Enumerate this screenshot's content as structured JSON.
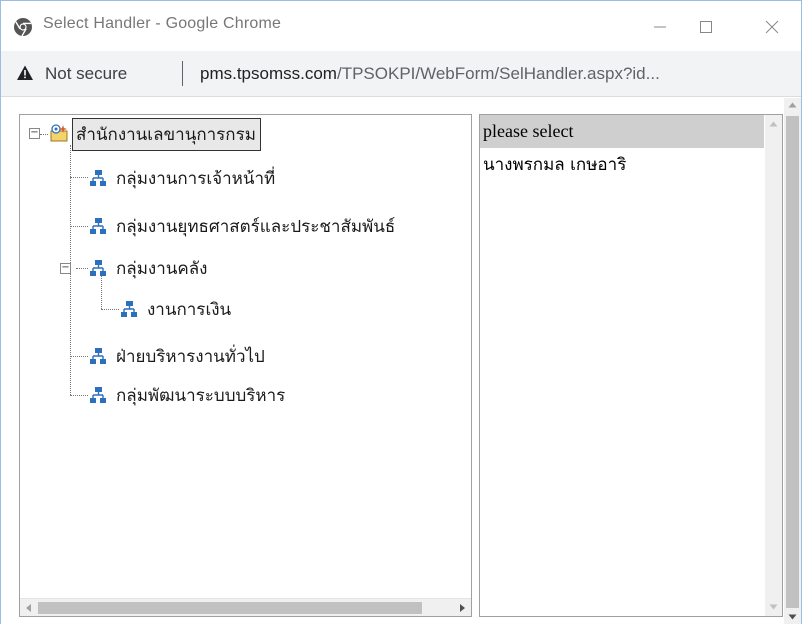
{
  "window": {
    "title": "Select Handler - Google Chrome",
    "controls": {
      "minimize": "minimize-icon",
      "maximize": "maximize-icon",
      "close": "close-icon"
    }
  },
  "addressbar": {
    "security_label": "Not secure",
    "url_host": "pms.tpsomss.com",
    "url_path": "/TPSOKPI/WebForm/SelHandler.aspx?id..."
  },
  "tree": {
    "root": {
      "label": "สำนักงานเลขานุการกรม",
      "icon": "folder-sparkle-icon",
      "expanded": true
    },
    "nodes": [
      {
        "label": "กลุ่มงานการเจ้าหน้าที่",
        "icon": "org-chart-icon"
      },
      {
        "label": "กลุ่มงานยุทธศาสตร์และประชาสัมพันธ์",
        "icon": "org-chart-icon"
      },
      {
        "label": "กลุ่มงานคลัง",
        "icon": "org-chart-icon",
        "expanded": true
      },
      {
        "label": "งานการเงิน",
        "icon": "org-chart-icon"
      },
      {
        "label": "ฝ่ายบริหารงานทั่วไป",
        "icon": "org-chart-icon"
      },
      {
        "label": "กลุ่มพัฒนาระบบบริหาร",
        "icon": "org-chart-icon"
      }
    ]
  },
  "list": {
    "items": [
      "please select",
      "นางพรกมล เกษอาริ"
    ],
    "selected_index": 0
  },
  "colors": {
    "accent": "#9dbde0",
    "selected_bg": "#cfcfcf",
    "scroll_thumb": "#c1c1c1",
    "org_icon": "#2b6fbd"
  }
}
